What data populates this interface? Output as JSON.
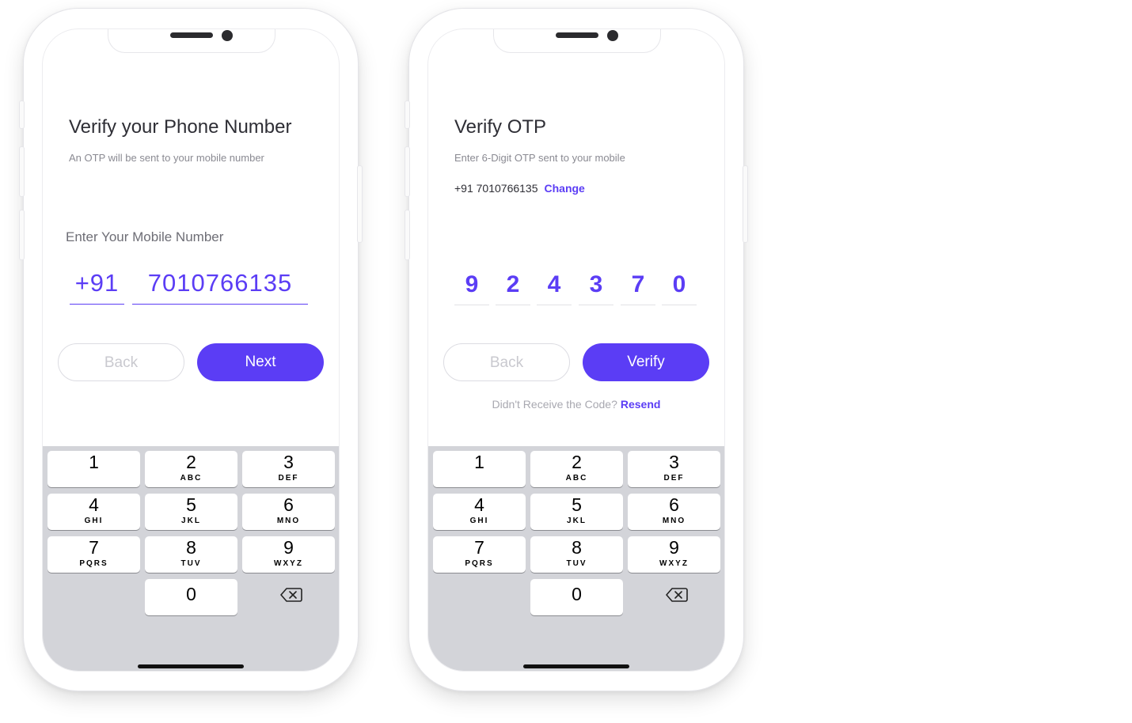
{
  "colors": {
    "accent": "#5b3df5",
    "keypad_background": "#d3d4d9"
  },
  "phone_number_screen": {
    "title": "Verify your Phone Number",
    "subtitle": "An OTP will be sent to your mobile number",
    "field_label": "Enter Your Mobile Number",
    "country_code": "+91",
    "mobile_number": "7010766135",
    "back_label": "Back",
    "next_label": "Next"
  },
  "otp_screen": {
    "title": "Verify OTP",
    "subtitle": "Enter 6-Digit OTP sent to your mobile",
    "phone_display": "+91 7010766135",
    "change_label": "Change",
    "otp_digits": [
      "9",
      "2",
      "4",
      "3",
      "7",
      "0"
    ],
    "back_label": "Back",
    "verify_label": "Verify",
    "resend_prompt": "Didn't Receive the Code?",
    "resend_label": "Resend"
  },
  "keypad": {
    "keys": [
      {
        "digit": "1",
        "letters": ""
      },
      {
        "digit": "2",
        "letters": "ABC"
      },
      {
        "digit": "3",
        "letters": "DEF"
      },
      {
        "digit": "4",
        "letters": "GHI"
      },
      {
        "digit": "5",
        "letters": "JKL"
      },
      {
        "digit": "6",
        "letters": "MNO"
      },
      {
        "digit": "7",
        "letters": "PQRS"
      },
      {
        "digit": "8",
        "letters": "TUV"
      },
      {
        "digit": "9",
        "letters": "WXYZ"
      },
      {
        "digit": "0",
        "letters": ""
      }
    ],
    "delete_icon": "backspace-icon"
  }
}
